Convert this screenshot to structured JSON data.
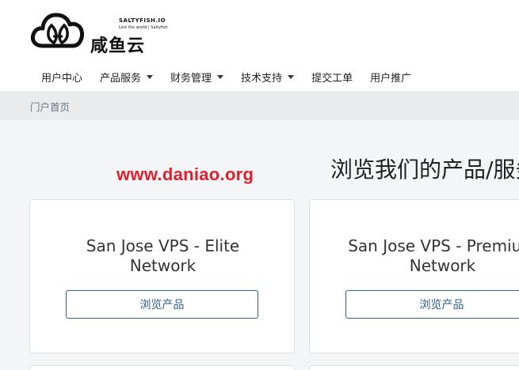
{
  "logo": {
    "brand": "SALTYFISH.IO",
    "tagline": "Link the world | Saltyfish",
    "name_cn": "咸鱼云"
  },
  "nav": {
    "items": [
      {
        "label": "用户中心",
        "dropdown": false
      },
      {
        "label": "产品服务",
        "dropdown": true
      },
      {
        "label": "财务管理",
        "dropdown": true
      },
      {
        "label": "技术支持",
        "dropdown": true
      },
      {
        "label": "提交工单",
        "dropdown": false
      },
      {
        "label": "用户推广",
        "dropdown": false
      }
    ]
  },
  "breadcrumb": {
    "current": "门户首页"
  },
  "watermark": "www.daniao.org",
  "main": {
    "heading": "浏览我们的产品/服务",
    "products": [
      {
        "title_line1": "San Jose VPS - Elite",
        "title_line2": "Network",
        "button_label": "浏览产品"
      },
      {
        "title_line1": "San Jose VPS - Premium",
        "title_line2": "Network",
        "button_label": "浏览产品"
      }
    ]
  },
  "colors": {
    "accent": "#2d5f8e",
    "watermark": "#e0202e",
    "breadcrumb_bg": "#e9ebed",
    "page_bg": "#f4f5f6"
  }
}
